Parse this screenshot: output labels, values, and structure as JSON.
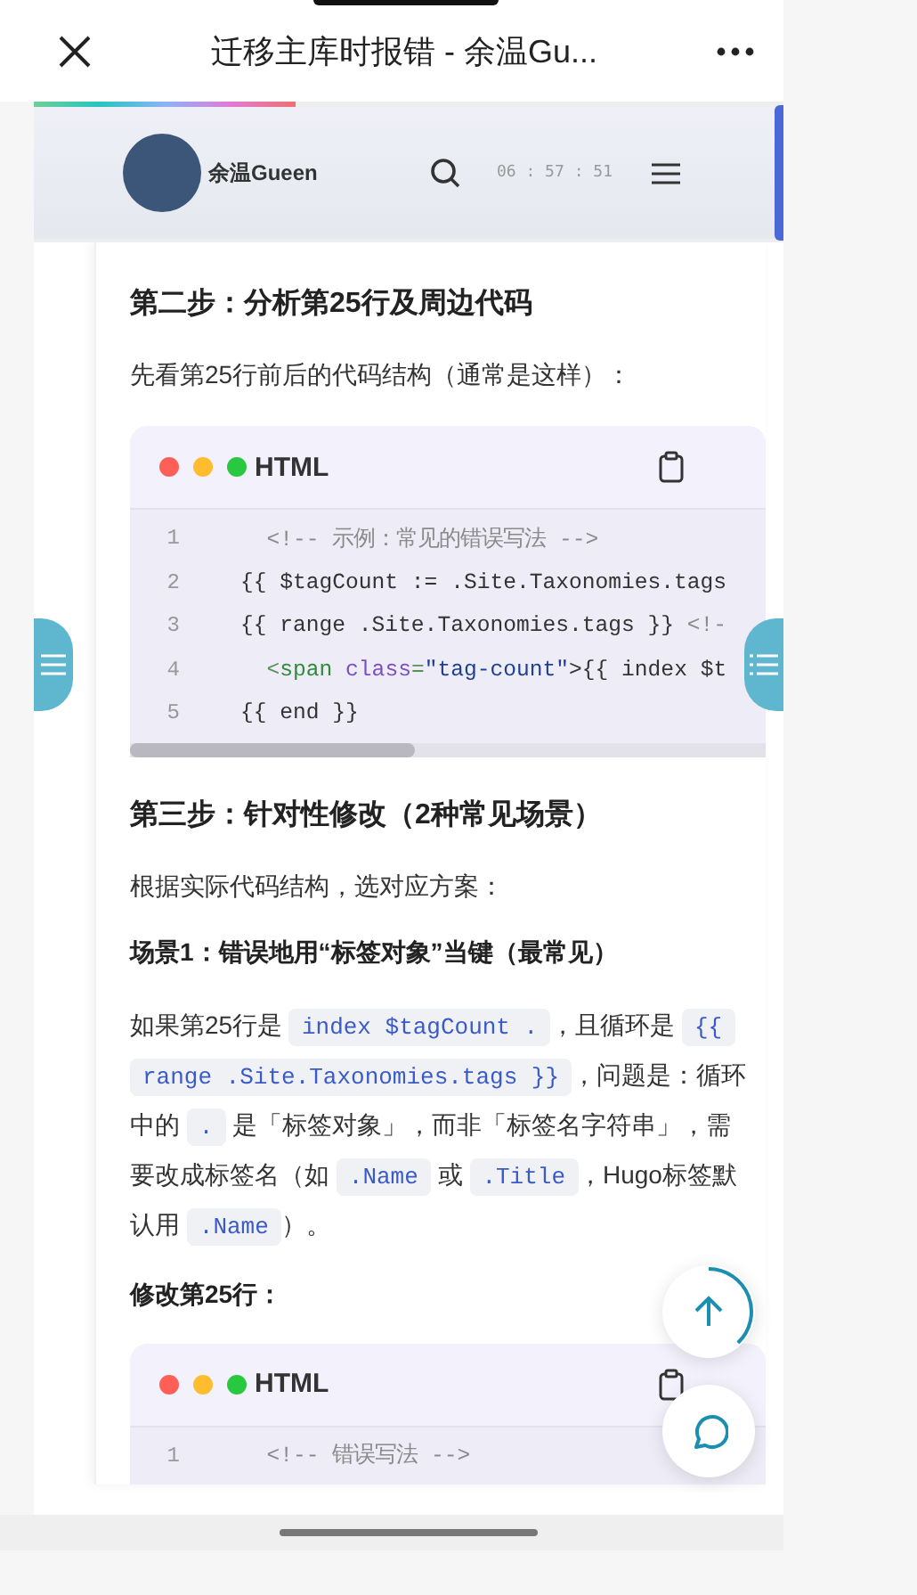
{
  "top_bar": {
    "title": "迁移主库时报错 - 余温Gu..."
  },
  "reading_progress": {
    "level": 0.35
  },
  "site_header": {
    "name": "余温Gueen",
    "time": "06 : 57 : 51"
  },
  "article": [
    {
      "kind": "heading",
      "text": "第二步：分析第25行及周边代码"
    },
    {
      "kind": "paragraph",
      "text": "先看第25行前后的代码结构（通常是这样）："
    },
    {
      "kind": "code",
      "language": "HTML",
      "scrollbar": true,
      "lines": [
        {
          "number": "1",
          "tokens": [
            {
              "kind": "comment",
              "text": "  <!-- 示例：常见的错误写法 -->"
            }
          ]
        },
        {
          "number": "2",
          "tokens": [
            {
              "kind": "plain",
              "text": "{{ $tagCount := .Site.Taxonomies.tags"
            }
          ]
        },
        {
          "number": "3",
          "tokens": [
            {
              "kind": "plain",
              "text": "{{ range .Site.Taxonomies.tags }} "
            },
            {
              "kind": "comment",
              "text": "<!-"
            }
          ]
        },
        {
          "number": "4",
          "tokens": [
            {
              "kind": "punct",
              "text": "  <"
            },
            {
              "kind": "tag",
              "text": "span"
            },
            {
              "kind": "attr",
              "text": " class"
            },
            {
              "kind": "punct",
              "text": "="
            },
            {
              "kind": "string",
              "text": "\"tag-count\""
            },
            {
              "kind": "plain",
              "text": ">{{ index $t"
            }
          ]
        },
        {
          "number": "5",
          "tokens": [
            {
              "kind": "plain",
              "text": "{{ end }}"
            }
          ]
        }
      ]
    },
    {
      "kind": "heading",
      "text": "第三步：针对性修改（2种常见场景）"
    },
    {
      "kind": "paragraph",
      "text": "根据实际代码结构，选对应方案："
    },
    {
      "kind": "subheading",
      "text": "场景1：错误地用“标签对象”当键（最常见）"
    },
    {
      "kind": "rich",
      "segments": [
        {
          "kind": "text",
          "text": "如果第25行是 "
        },
        {
          "kind": "code",
          "text": "index $tagCount ."
        },
        {
          "kind": "text",
          "text": "，且循环是 "
        },
        {
          "kind": "code",
          "text": "{{ range .Site.Taxonomies.tags }}"
        },
        {
          "kind": "text",
          "text": "，问题是：循环中的 "
        },
        {
          "kind": "code",
          "text": "."
        },
        {
          "kind": "text",
          "text": " 是「标签对象」，而非「标签名字符串」，需要改成标签名（如 "
        },
        {
          "kind": "code",
          "text": ".Name"
        },
        {
          "kind": "text",
          "text": " 或 "
        },
        {
          "kind": "code",
          "text": ".Title"
        },
        {
          "kind": "text",
          "text": "，Hugo标签默认用 "
        },
        {
          "kind": "code",
          "text": ".Name"
        },
        {
          "kind": "text",
          "text": "）。"
        }
      ]
    },
    {
      "kind": "subheading",
      "text": "修改第25行："
    },
    {
      "kind": "code",
      "language": "HTML",
      "scrollbar": false,
      "lines": [
        {
          "number": "1",
          "tokens": [
            {
              "kind": "comment",
              "text": "  <!-- 错误写法 -->"
            }
          ]
        }
      ]
    }
  ]
}
